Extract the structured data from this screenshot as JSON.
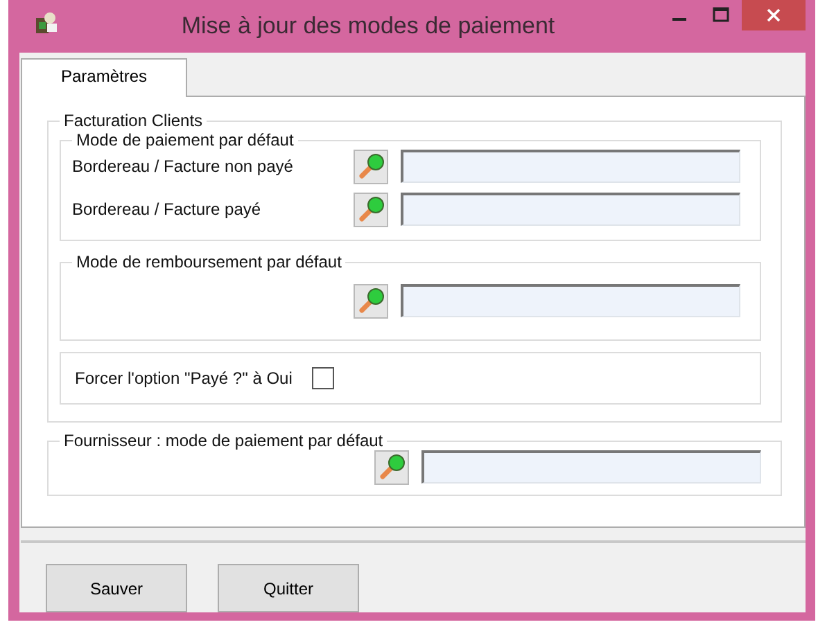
{
  "window": {
    "title": "Mise à jour des modes de paiement"
  },
  "tabs": [
    {
      "label": "Paramètres",
      "selected": true
    }
  ],
  "client_billing": {
    "title": "Facturation Clients",
    "groups": [
      {
        "kind": "lookups",
        "title": "Mode de paiement par défaut",
        "rows": [
          {
            "kind": "lookup",
            "label": "Bordereau / Facture non payé"
          },
          {
            "kind": "lookup",
            "label": "Bordereau / Facture payé"
          }
        ]
      },
      {
        "kind": "lookups",
        "title": "Mode de remboursement par défaut",
        "rows": [
          {
            "kind": "lookup"
          }
        ]
      },
      {
        "kind": "checkbox",
        "label": "Forcer l'option \"Payé ?\" à Oui",
        "checked": false
      }
    ]
  },
  "supplier": {
    "title": "Fournisseur : mode de paiement par défaut",
    "rows": [
      {
        "kind": "lookup"
      }
    ]
  },
  "buttons": [
    "Sauver",
    "Quitter"
  ]
}
